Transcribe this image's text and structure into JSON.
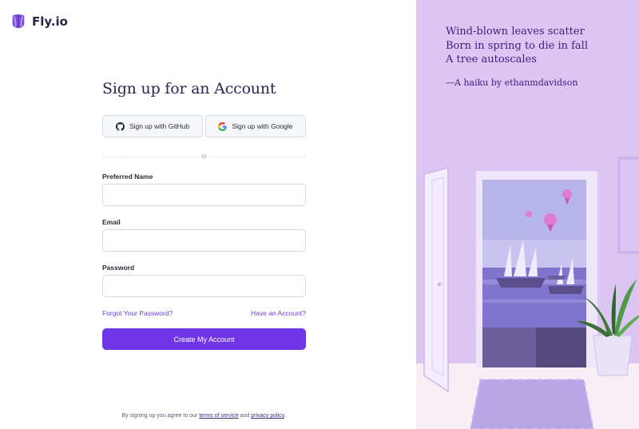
{
  "brand": {
    "name": "Fly.io"
  },
  "form": {
    "title": "Sign up for an Account",
    "github_label": "Sign up with GitHub",
    "google_label": "Sign up with Google",
    "divider": "or",
    "name_label": "Preferred Name",
    "name_value": "",
    "email_label": "Email",
    "email_value": "",
    "password_label": "Password",
    "password_value": "",
    "forgot_link": "Forgot Your Password?",
    "have_account_link": "Have an Account?",
    "submit_label": "Create My Account"
  },
  "terms": {
    "prefix": "By signing up you agree to our ",
    "terms_link": "terms of service",
    "and": " and ",
    "privacy_link": "privacy policy",
    "suffix": "."
  },
  "haiku": {
    "line1": "Wind-blown leaves scatter",
    "line2": "Born in spring to die in fall",
    "line3": "A tree autoscales",
    "attribution": "—A haiku by ethanmdavidson"
  },
  "colors": {
    "accent": "#6f35e6",
    "panel": "#dcc5f3",
    "link": "#6b3fe0"
  },
  "icons": {
    "logo": "fly-balloon-icon",
    "github": "github-icon",
    "google": "google-icon"
  }
}
